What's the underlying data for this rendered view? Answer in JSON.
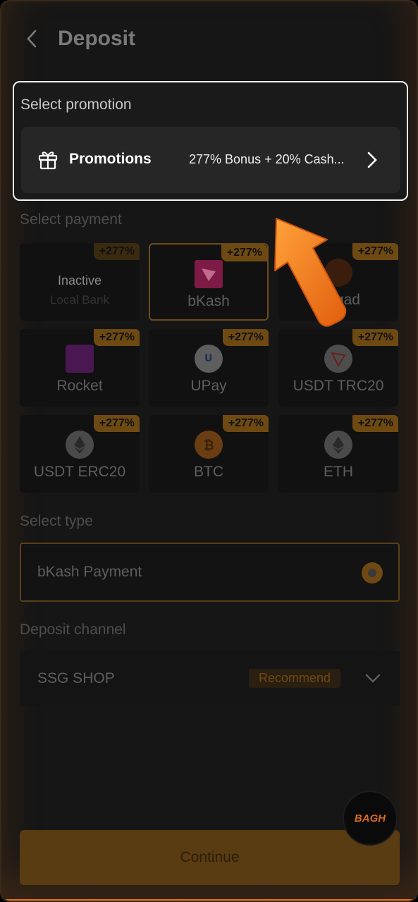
{
  "header": {
    "title": "Deposit"
  },
  "promotion": {
    "section_label": "Select promotion",
    "title": "Promotions",
    "value": "277% Bonus + 20% Cash..."
  },
  "payment": {
    "section_label": "Select payment",
    "items": [
      {
        "name": "Local Bank",
        "badge": "+277%",
        "status": "Inactive"
      },
      {
        "name": "bKash",
        "badge": "+277%"
      },
      {
        "name": "Nagad",
        "badge": "+277%"
      },
      {
        "name": "Rocket",
        "badge": "+277%"
      },
      {
        "name": "UPay",
        "badge": "+277%"
      },
      {
        "name": "USDT TRC20",
        "badge": "+277%"
      },
      {
        "name": "USDT ERC20",
        "badge": "+277%"
      },
      {
        "name": "BTC",
        "badge": "+277%"
      },
      {
        "name": "ETH",
        "badge": "+277%"
      }
    ]
  },
  "type": {
    "section_label": "Select type",
    "value": "bKash Payment"
  },
  "channel": {
    "section_label": "Deposit channel",
    "value": "SSG SHOP",
    "tag": "Recommend"
  },
  "actions": {
    "continue_label": "Continue"
  },
  "logo": {
    "text": "BAGH"
  },
  "colors": {
    "accent": "#e8751a",
    "badge": "#6e4a12",
    "arrow": "#f07a1a"
  }
}
